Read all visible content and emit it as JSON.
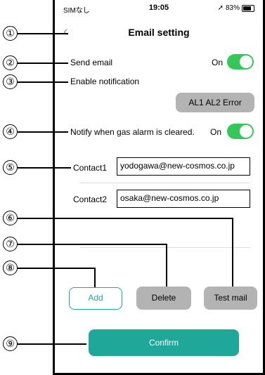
{
  "status_bar": {
    "carrier": "SIMなし",
    "time": "19:05",
    "battery": "83%"
  },
  "nav": {
    "title": "Email setting"
  },
  "send_email": {
    "label": "Send email",
    "state": "On"
  },
  "notification": {
    "label": "Enable notification",
    "alarms": "AL1  AL2  Error"
  },
  "gas_alarm": {
    "label": "Notify when gas alarm is cleared.",
    "state": "On"
  },
  "contacts": [
    {
      "label": "Contact1",
      "value": "yodogawa@new-cosmos.co.jp"
    },
    {
      "label": "Contact2",
      "value": "osaka@new-cosmos.co.jp"
    }
  ],
  "buttons": {
    "add": "Add",
    "delete": "Delete",
    "test_mail": "Test mail",
    "confirm": "Confirm"
  },
  "callouts": [
    "①",
    "②",
    "③",
    "④",
    "⑤",
    "⑥",
    "⑦",
    "⑧",
    "⑨"
  ],
  "colors": {
    "toggle_on": "#35c759",
    "accent": "#1fa89a",
    "button_gray": "#b3b3b3"
  }
}
